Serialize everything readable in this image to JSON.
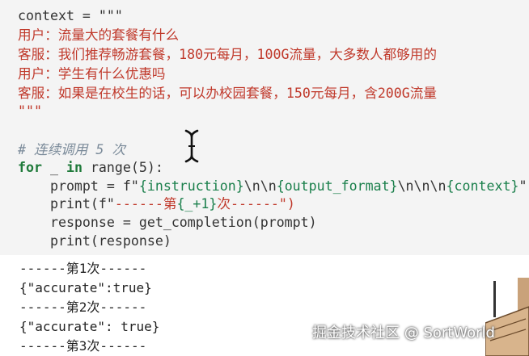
{
  "code": {
    "context_open": "context = \"\"\"",
    "dialog": [
      "用户：流量大的套餐有什么",
      "客服：我们推荐畅游套餐，180元每月，100G流量，大多数人都够用的",
      "用户：学生有什么优惠吗",
      "客服：如果是在校生的话，可以办校园套餐，150元每月，含200G流量"
    ],
    "context_close": "\"\"\"",
    "comment": "# 连续调用 5 次",
    "for_kw": "for",
    "for_var": " _ ",
    "in_kw": "in",
    "for_rest": " range(5):",
    "prompt_line_a": "    prompt = f\"",
    "prompt_line_b": "{instruction}",
    "prompt_line_c": "\\n\\n",
    "prompt_line_d": "{output_format}",
    "prompt_line_e": "\\n\\n\\n",
    "prompt_line_f": "{context}",
    "prompt_line_g": "\"",
    "print_line_a": "    print(f\"",
    "print_line_b": "------第",
    "print_line_c": "{_+1}",
    "print_line_d": "次------\")",
    "response_line": "    response = get_completion(prompt)",
    "print_response": "    print(response)"
  },
  "output": [
    "------第1次------",
    "{\"accurate\":true}",
    "------第2次------",
    "{\"accurate\": true}",
    "------第3次------"
  ],
  "watermark": "掘金技术社区 @ SortWorld",
  "icons": {
    "cursor": "text-cursor-icon",
    "corner": "character-illustration-icon"
  }
}
